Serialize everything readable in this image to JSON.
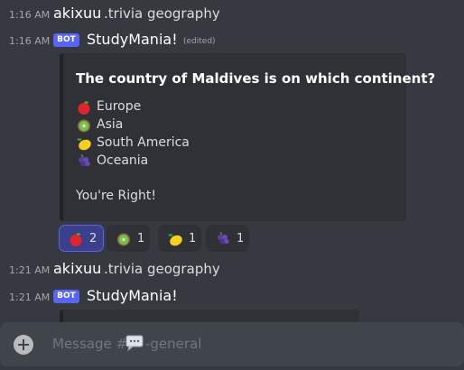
{
  "messages": [
    {
      "timestamp": "1:16 AM",
      "author": "akixuu",
      "content": ".trivia geography"
    },
    {
      "timestamp": "1:16 AM",
      "bot_tag": "BOT",
      "author": "StudyMania!",
      "edited": "(edited)"
    },
    {
      "timestamp": "1:21 AM",
      "author": "akixuu",
      "content": ".trivia geography"
    },
    {
      "timestamp": "1:21 AM",
      "bot_tag": "BOT",
      "author": "StudyMania!"
    }
  ],
  "embed": {
    "title": "The country of Maldives is on which continent?",
    "options": [
      {
        "emoji": "apple-emoji",
        "label": "Europe"
      },
      {
        "emoji": "kiwi-emoji",
        "label": "Asia"
      },
      {
        "emoji": "lemon-emoji",
        "label": "South America"
      },
      {
        "emoji": "grapes-emoji",
        "label": "Oceania"
      }
    ],
    "result": "You're Right!"
  },
  "reactions": [
    {
      "emoji": "apple-emoji",
      "count": "2",
      "active": true
    },
    {
      "emoji": "kiwi-emoji",
      "count": "1",
      "active": false
    },
    {
      "emoji": "lemon-emoji",
      "count": "1",
      "active": false
    },
    {
      "emoji": "grapes-emoji",
      "count": "1",
      "active": false
    }
  ],
  "composer": {
    "placeholder_prefix": "Message #",
    "channel_icon": "speech-balloon-icon",
    "placeholder_suffix": "-general"
  },
  "colors": {
    "background": "#36393f",
    "embed_bg": "#2f3136",
    "blurple": "#5865f2",
    "composer_bg": "#40444b"
  }
}
